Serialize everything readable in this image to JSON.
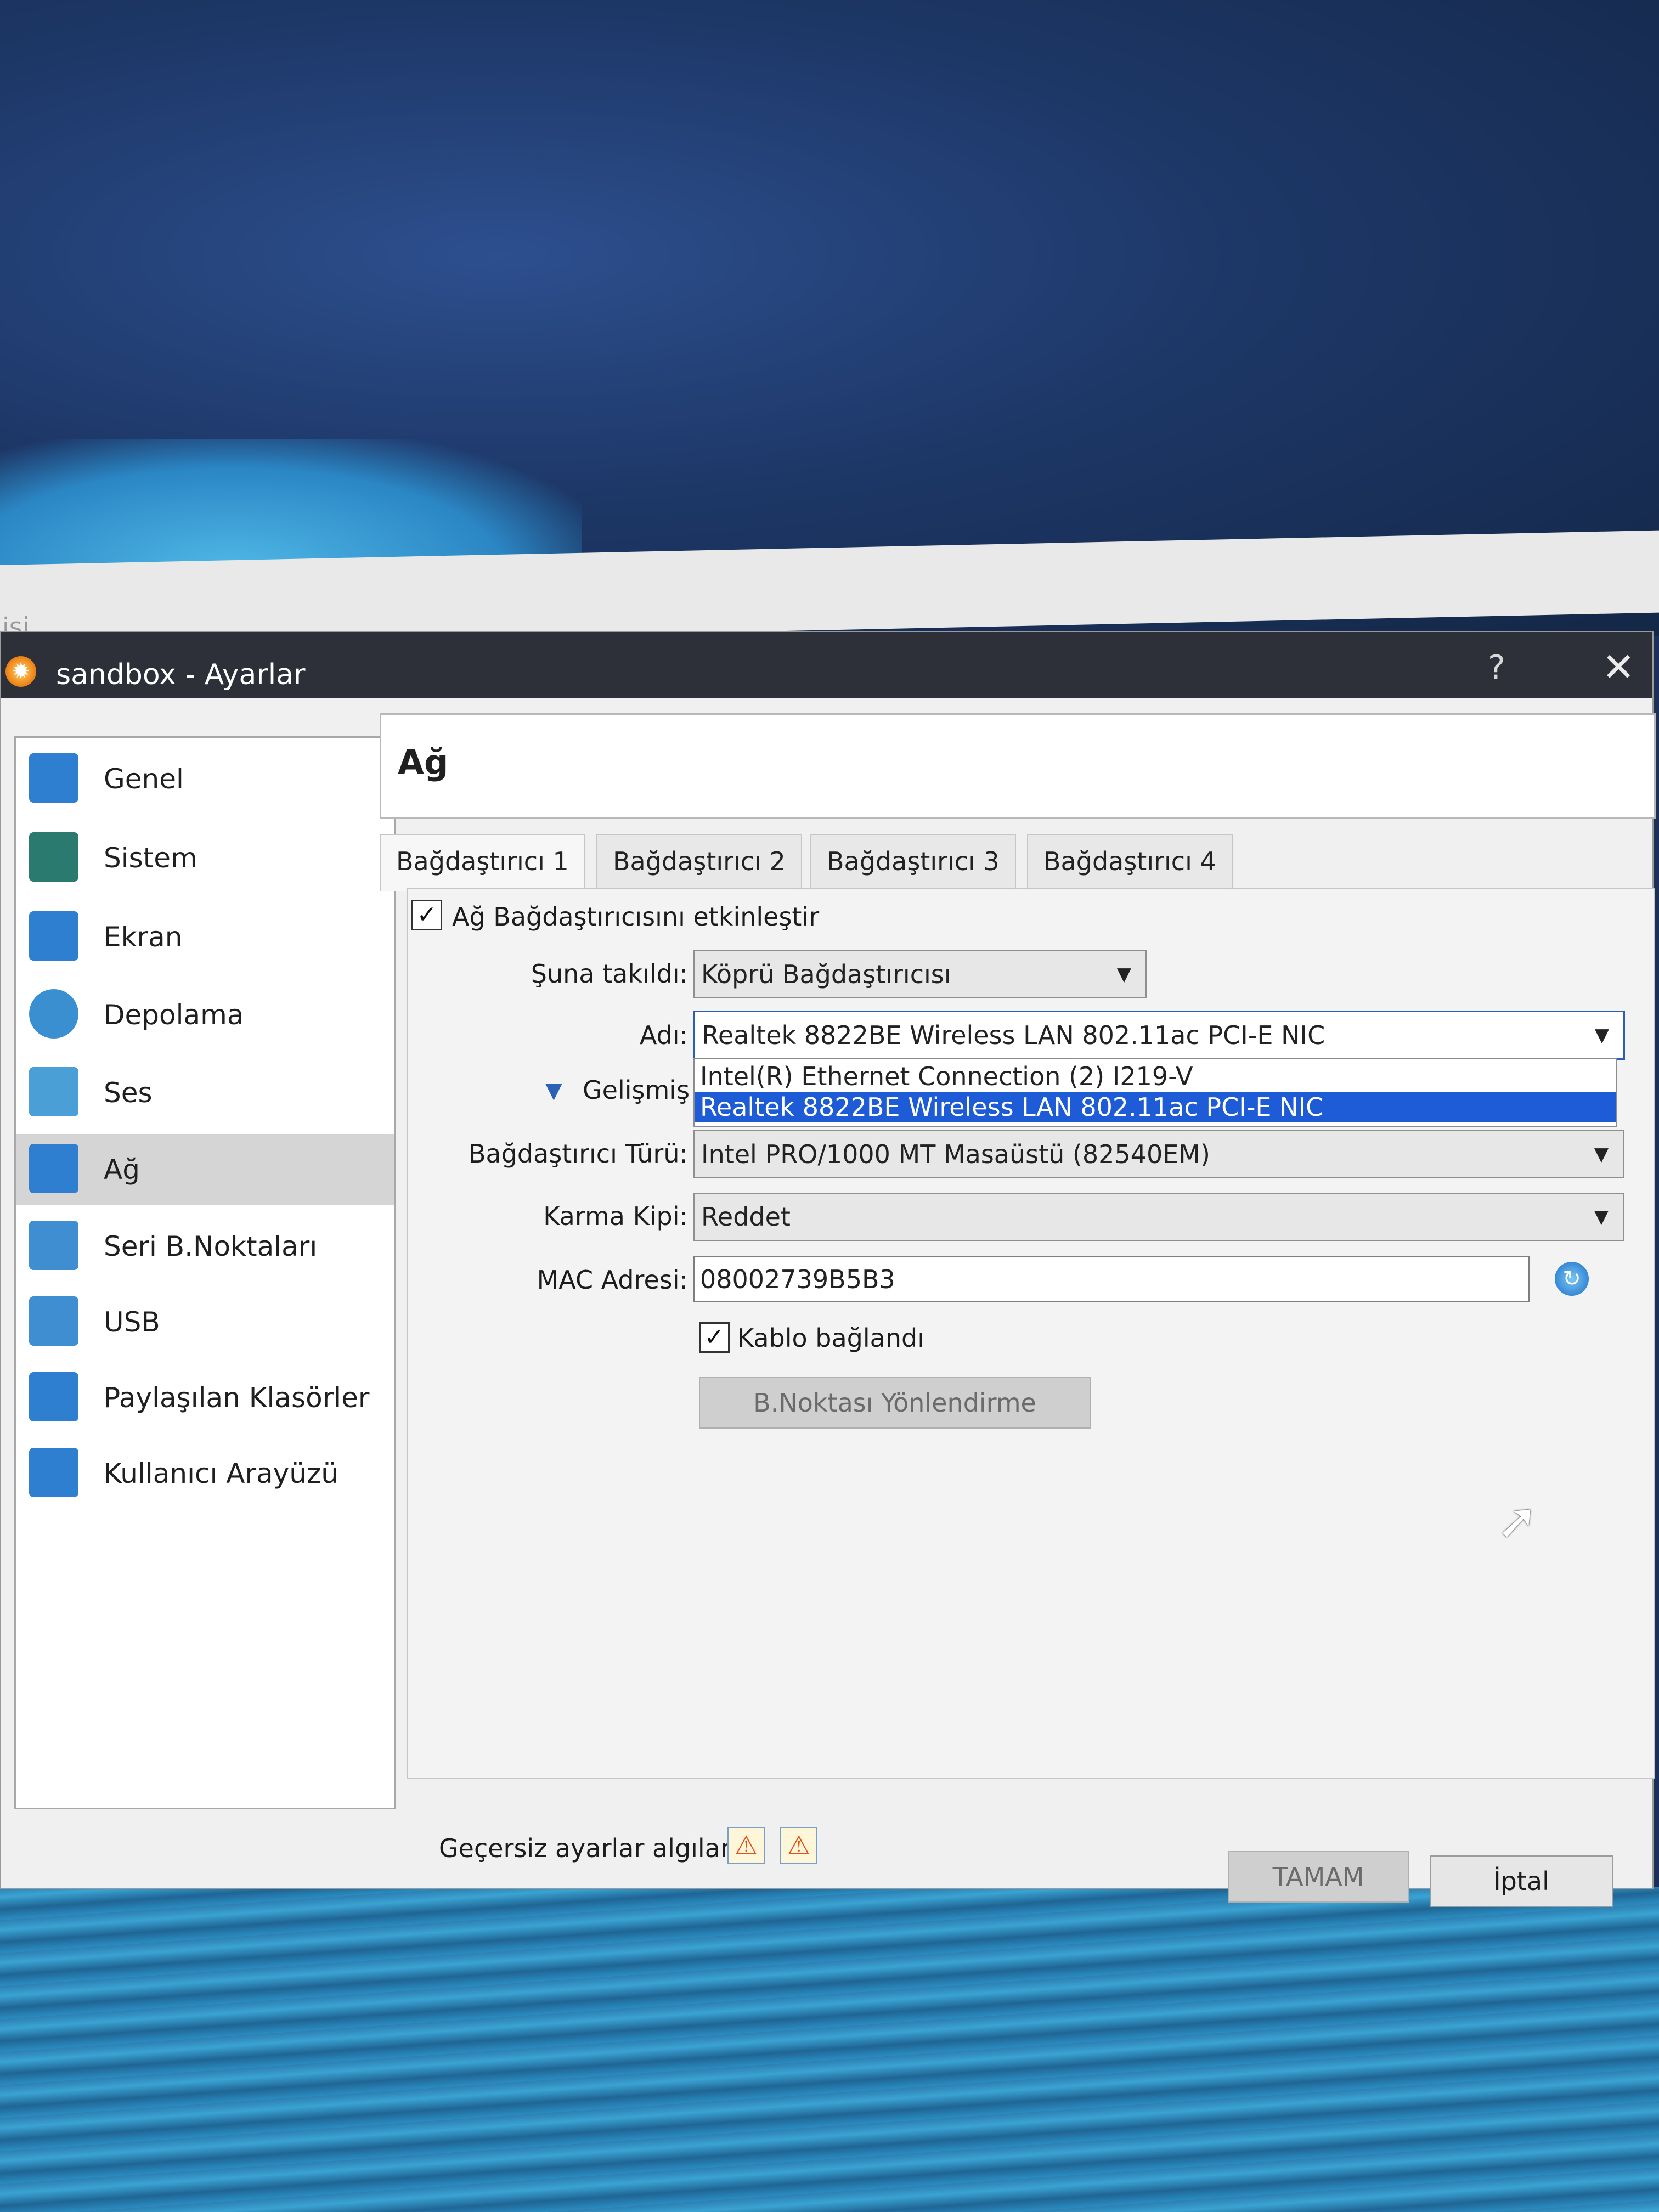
{
  "window": {
    "title": "sandbox - Ayarlar",
    "help": "?",
    "close": "✕",
    "background_label": "isi"
  },
  "sidebar": {
    "items": [
      {
        "label": "Genel",
        "icon": "monitor-icon",
        "color": "#2f7fd0"
      },
      {
        "label": "Sistem",
        "icon": "chip-icon",
        "color": "#2b7a6f"
      },
      {
        "label": "Ekran",
        "icon": "display-icon",
        "color": "#2f7fd0"
      },
      {
        "label": "Depolama",
        "icon": "disk-icon",
        "color": "#3a8fd1"
      },
      {
        "label": "Ses",
        "icon": "speaker-icon",
        "color": "#4a9fd6"
      },
      {
        "label": "Ağ",
        "icon": "network-icon",
        "color": "#2f7fd0"
      },
      {
        "label": "Seri B.Noktaları",
        "icon": "serial-port-icon",
        "color": "#3f8ed2"
      },
      {
        "label": "USB",
        "icon": "usb-icon",
        "color": "#3f8ed2"
      },
      {
        "label": "Paylaşılan Klasörler",
        "icon": "folder-icon",
        "color": "#2f7fd0"
      },
      {
        "label": "Kullanıcı Arayüzü",
        "icon": "window-icon",
        "color": "#2f7fd0"
      }
    ],
    "selected": "Ağ"
  },
  "header": {
    "title": "Ağ"
  },
  "tabs": [
    {
      "label": "Bağdaştırıcı 1",
      "active": true
    },
    {
      "label": "Bağdaştırıcı 2",
      "active": false
    },
    {
      "label": "Bağdaştırıcı 3",
      "active": false
    },
    {
      "label": "Bağdaştırıcı 4",
      "active": false
    }
  ],
  "form": {
    "enable_label": "Ağ Bağdaştırıcısını etkinleştir",
    "enable_checked": "✓",
    "attached_label": "Şuna takıldı:",
    "attached_value": "Köprü Bağdaştırıcısı",
    "name_label": "Adı:",
    "name_value": "Realtek 8822BE Wireless LAN 802.11ac PCI-E NIC",
    "name_options": [
      "Intel(R) Ethernet Connection (2) I219-V",
      "Realtek 8822BE Wireless LAN 802.11ac PCI-E NIC"
    ],
    "advanced_label": "Gelişmiş",
    "adapter_type_label": "Bağdaştırıcı Türü:",
    "adapter_type_value": "Intel PRO/1000 MT Masaüstü (82540EM)",
    "promisc_label": "Karma Kipi:",
    "promisc_value": "Reddet",
    "mac_label": "MAC Adresi:",
    "mac_value": "08002739B5B3",
    "cable_label": "Kablo bağlandı",
    "cable_checked": "✓",
    "port_forward_label": "B.Noktası Yönlendirme"
  },
  "footer": {
    "invalid_text": "Geçersiz ayarlar algılandı",
    "ok_label": "TAMAM",
    "cancel_label": "İptal"
  }
}
